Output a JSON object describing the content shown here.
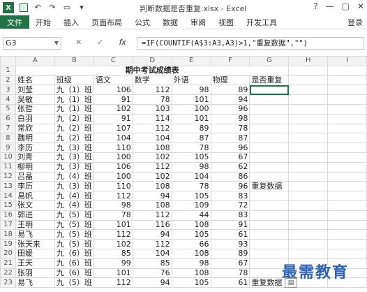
{
  "window": {
    "app_icon": "X",
    "title": "判断数据是否重复.xlsx - Excel",
    "minimize": "?",
    "maximize": "—",
    "restore": "▢",
    "close": "✕"
  },
  "qat": {
    "undo": "↶",
    "redo": "↷",
    "open": "▭",
    "more": "▾"
  },
  "ribbon": {
    "file": "文件",
    "tabs": [
      "开始",
      "插入",
      "页面布局",
      "公式",
      "数据",
      "审阅",
      "视图",
      "开发工具"
    ],
    "login": "登录"
  },
  "formula_bar": {
    "name_box": "G3",
    "cancel": "✕",
    "enter": "✓",
    "fx": "fx",
    "formula": "=IF(COUNTIF(A$3:A3,A3)>1,\"重复数据\",\"\")"
  },
  "columns": [
    "A",
    "B",
    "C",
    "D",
    "E",
    "F",
    "G",
    "H",
    "I"
  ],
  "rows": [
    1,
    2,
    3,
    4,
    5,
    6,
    7,
    8,
    9,
    10,
    11,
    12,
    13,
    14,
    15,
    16,
    17,
    18,
    19,
    20,
    21,
    22,
    23
  ],
  "sheet_title": "期中考试成绩表",
  "headers": [
    "姓名",
    "班级",
    "语文",
    "数学",
    "外语",
    "物理",
    "是否重复"
  ],
  "records": [
    [
      "刘莹",
      "九（1）班",
      "106",
      "112",
      "98",
      "89",
      ""
    ],
    [
      "吴敏",
      "九（1）班",
      "91",
      "78",
      "101",
      "94",
      ""
    ],
    [
      "张哲",
      "九（1）班",
      "102",
      "103",
      "100",
      "96",
      ""
    ],
    [
      "白羽",
      "九（2）班",
      "91",
      "114",
      "101",
      "98",
      ""
    ],
    [
      "常欣",
      "九（2）班",
      "107",
      "112",
      "89",
      "78",
      ""
    ],
    [
      "魏明",
      "九（2）班",
      "104",
      "104",
      "87",
      "87",
      ""
    ],
    [
      "李历",
      "九（3）班",
      "110",
      "108",
      "78",
      "96",
      ""
    ],
    [
      "刘青",
      "九（3）班",
      "100",
      "102",
      "105",
      "67",
      ""
    ],
    [
      "柳明",
      "九（3）班",
      "106",
      "112",
      "98",
      "62",
      ""
    ],
    [
      "吕晶",
      "九（4）班",
      "100",
      "102",
      "104",
      "86",
      ""
    ],
    [
      "李历",
      "九（3）班",
      "110",
      "108",
      "78",
      "96",
      "重复数据"
    ],
    [
      "易帆",
      "九（4）班",
      "112",
      "94",
      "105",
      "83",
      ""
    ],
    [
      "张文",
      "九（4）班",
      "98",
      "108",
      "109",
      "72",
      ""
    ],
    [
      "郭进",
      "九（5）班",
      "78",
      "112",
      "44",
      "83",
      ""
    ],
    [
      "王明",
      "九（5）班",
      "101",
      "116",
      "108",
      "91",
      ""
    ],
    [
      "易飞",
      "九（5）班",
      "112",
      "94",
      "105",
      "61",
      ""
    ],
    [
      "张天来",
      "九（5）班",
      "102",
      "112",
      "66",
      "93",
      ""
    ],
    [
      "田媛",
      "九（6）班",
      "85",
      "104",
      "108",
      "89",
      ""
    ],
    [
      "王天",
      "九（6）班",
      "99",
      "85",
      "98",
      "67",
      ""
    ],
    [
      "张羽",
      "九（6）班",
      "101",
      "76",
      "108",
      "78",
      ""
    ],
    [
      "易飞",
      "九（5）班",
      "112",
      "94",
      "105",
      "61",
      "重复数据"
    ]
  ],
  "watermark": "最需教育",
  "paste_options": "▤"
}
